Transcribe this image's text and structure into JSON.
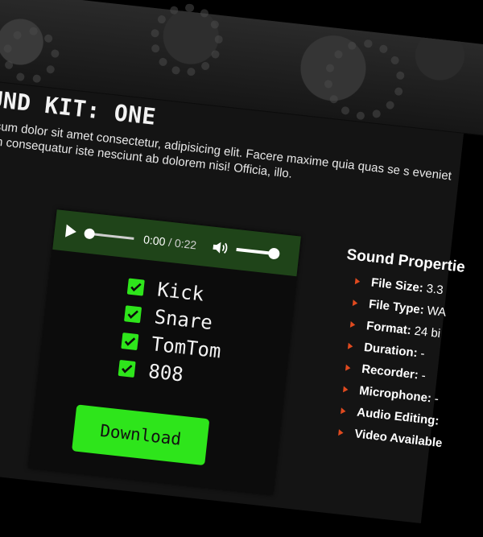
{
  "page": {
    "title": "OUND KIT: ONE",
    "description": "m ipsum dolor sit amet consectetur, adipisicing elit. Facere maxime quia quas se s eveniet ipsam consequatur iste nesciunt ab dolorem nisi! Officia, illo."
  },
  "player": {
    "current_time": "0:00",
    "separator": " / ",
    "duration": "0:22",
    "progress": 0,
    "volume": 1.0,
    "icons": {
      "play": "play-icon",
      "volume": "volume-icon"
    }
  },
  "kit_items": [
    {
      "label": "Kick",
      "checked": true
    },
    {
      "label": "Snare",
      "checked": true
    },
    {
      "label": "TomTom",
      "checked": true
    },
    {
      "label": "808",
      "checked": true
    }
  ],
  "download_label": "Download",
  "properties": {
    "heading": "Sound Propertie",
    "items": [
      {
        "label": "File Size:",
        "value": "3.3"
      },
      {
        "label": "File Type:",
        "value": "WA"
      },
      {
        "label": "Format:",
        "value": "24 bi"
      },
      {
        "label": "Duration:",
        "value": "-"
      },
      {
        "label": "Recorder:",
        "value": "-"
      },
      {
        "label": "Microphone:",
        "value": "-"
      },
      {
        "label": "Audio Editing:",
        "value": ""
      },
      {
        "label": "Video Available",
        "value": ""
      }
    ]
  },
  "colors": {
    "accent_green": "#2ee51b",
    "player_bg": "#1f4419",
    "bullet_orange": "#e04a1f",
    "page_bg": "#141414"
  }
}
